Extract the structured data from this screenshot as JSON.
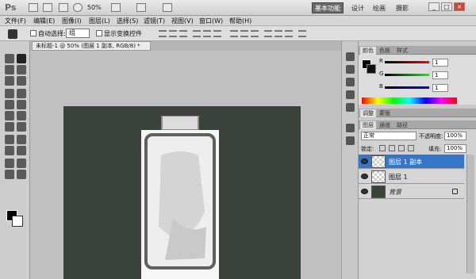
{
  "app": {
    "logo": "Ps",
    "zoom": "50%"
  },
  "workspace": {
    "active": "基本功能",
    "items": [
      "设计",
      "绘画",
      "摄影"
    ]
  },
  "window_buttons": [
    "_",
    "□",
    "×"
  ],
  "menus": [
    "文件(F)",
    "编辑(E)",
    "图像(I)",
    "图层(L)",
    "选择(S)",
    "滤镜(T)",
    "视图(V)",
    "窗口(W)",
    "帮助(H)"
  ],
  "options": {
    "auto_select": "自动选择:",
    "group_value": "组",
    "show_transform": "显示变换控件"
  },
  "document": {
    "tab_title": "未标题-1 @ 50% (图层 1 副本, RGB/8) *"
  },
  "color_panel": {
    "tabs": [
      "颜色",
      "色板",
      "样式"
    ],
    "channels": [
      {
        "name": "R",
        "value": "1"
      },
      {
        "name": "G",
        "value": "1"
      },
      {
        "name": "B",
        "value": "1"
      }
    ]
  },
  "adjust_tabs": [
    "调整",
    "蒙版"
  ],
  "layers": {
    "tabs": [
      "图层",
      "通道",
      "路径"
    ],
    "blend_mode": "正常",
    "opacity_label": "不透明度:",
    "opacity": "100%",
    "lock_label": "锁定:",
    "fill_label": "填充:",
    "fill": "100%",
    "items": [
      {
        "name": "图层 1 副本",
        "selected": true
      },
      {
        "name": "图层 1",
        "selected": false
      },
      {
        "name": "背景",
        "selected": false
      }
    ]
  }
}
